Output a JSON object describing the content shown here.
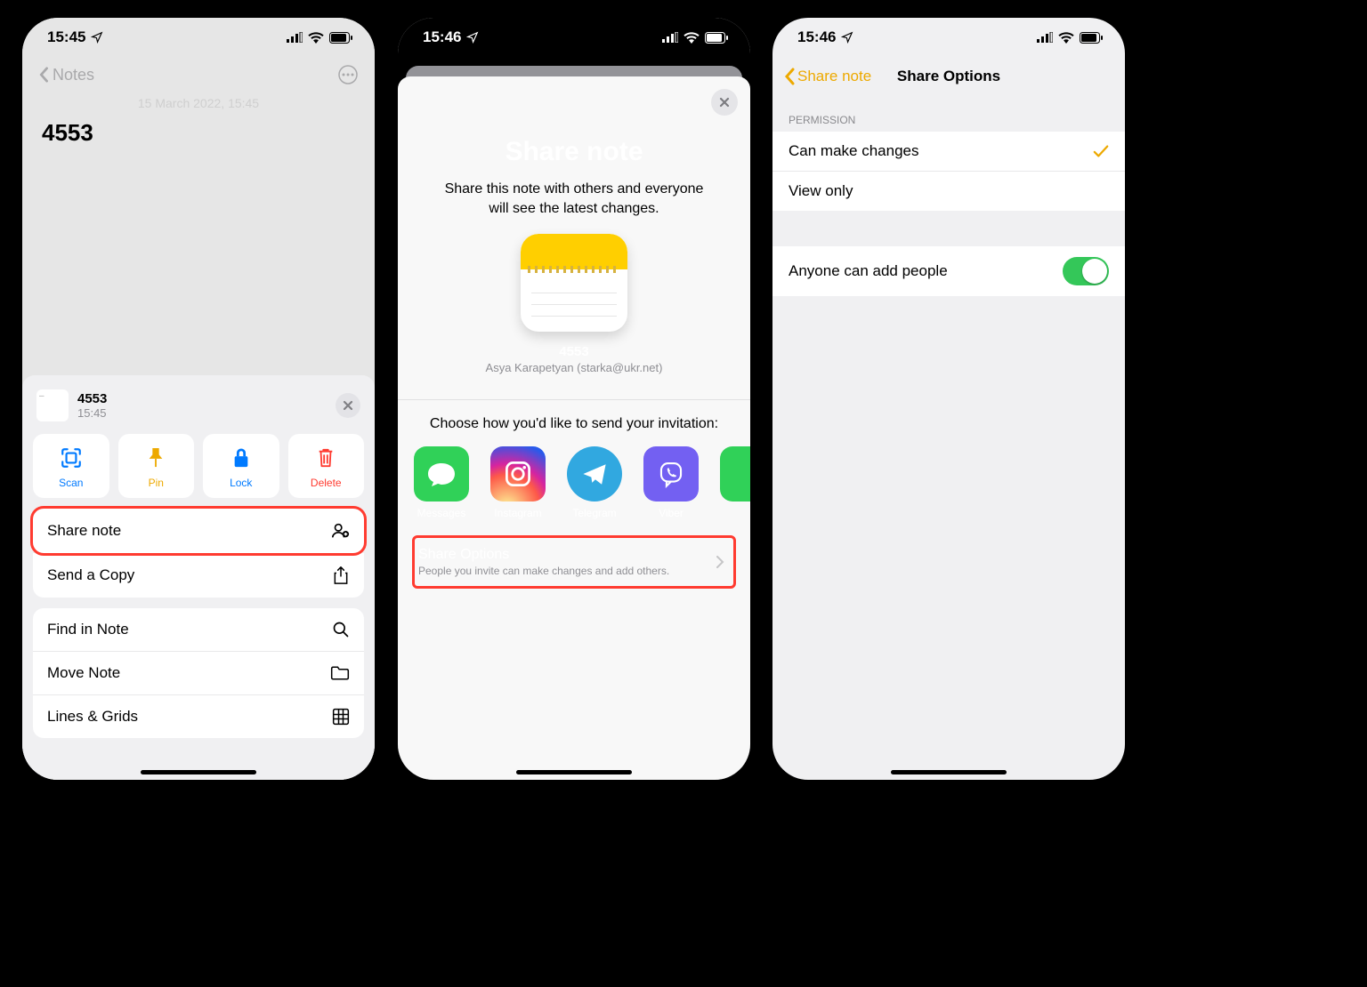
{
  "colors": {
    "accent_yellow": "#eda900",
    "ios_blue": "#007aff",
    "danger": "#ff3b30",
    "toggle_green": "#34c759"
  },
  "phone1": {
    "status_time": "15:45",
    "nav_back_label": "Notes",
    "note_meta": "15 March 2022, 15:45",
    "note_title": "4553",
    "sheet": {
      "note_title": "4553",
      "note_time": "15:45",
      "actions": [
        {
          "label": "Scan",
          "icon": "scan-icon",
          "tone": "scan"
        },
        {
          "label": "Pin",
          "icon": "pin-icon",
          "tone": "pin"
        },
        {
          "label": "Lock",
          "icon": "lock-icon",
          "tone": "lock"
        },
        {
          "label": "Delete",
          "icon": "trash-icon",
          "tone": "del"
        }
      ],
      "menu": [
        {
          "label": "Share note",
          "icon": "share-people-icon",
          "highlight": true
        },
        {
          "label": "Send a Copy",
          "icon": "share-up-icon"
        },
        {
          "label": "Find in Note",
          "icon": "search-icon"
        },
        {
          "label": "Move Note",
          "icon": "folder-icon"
        },
        {
          "label": "Lines & Grids",
          "icon": "grid-icon"
        }
      ]
    }
  },
  "phone2": {
    "status_time": "15:46",
    "title": "Share note",
    "description": "Share this note with others and everyone will see the latest changes.",
    "note_title": "4553",
    "owner": "Asya Karapetyan (starka@ukr.net)",
    "choose_label": "Choose how you'd like to send your invitation:",
    "apps": [
      {
        "name": "Messages",
        "icon": "messages-icon",
        "bg": "bg-msg"
      },
      {
        "name": "Instagram",
        "icon": "instagram-icon",
        "bg": "bg-ig"
      },
      {
        "name": "Telegram",
        "icon": "telegram-icon",
        "bg": "bg-tg"
      },
      {
        "name": "Viber",
        "icon": "viber-icon",
        "bg": "bg-vb"
      }
    ],
    "options_title": "Share Options",
    "options_subtitle": "People you invite can make changes and add others."
  },
  "phone3": {
    "status_time": "15:46",
    "back_label": "Share note",
    "title": "Share Options",
    "section_label": "Permission",
    "rows": [
      {
        "label": "Can make changes",
        "checked": true
      },
      {
        "label": "View only",
        "checked": false
      }
    ],
    "anyone_label": "Anyone can add people",
    "anyone_toggle_on": true
  }
}
